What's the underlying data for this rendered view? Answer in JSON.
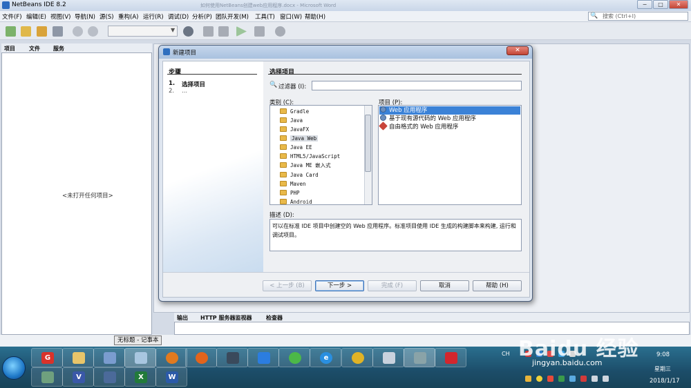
{
  "app": {
    "title": "NetBeans IDE 8.2",
    "background_doc_title": "如何使用NetBeans创建web应用程序.docx - Microsoft Word"
  },
  "menubar": {
    "items": [
      "文件(F)",
      "编辑(E)",
      "视图(V)",
      "导航(N)",
      "源(S)",
      "重构(A)",
      "运行(R)",
      "调试(D)",
      "分析(P)",
      "团队开发(M)",
      "工具(T)",
      "窗口(W)",
      "帮助(H)"
    ],
    "search_placeholder": "搜索 (Ctrl+I)"
  },
  "project_panel": {
    "tabs": [
      "项目",
      "文件",
      "服务"
    ],
    "empty_text": "<未打开任何项目>"
  },
  "output_panel": {
    "tabs": [
      "输出",
      "HTTP 服务器监视器",
      "检查器"
    ]
  },
  "tooltip": "无标题 - 记事本",
  "dialog": {
    "title": "新建项目",
    "steps_heading": "步骤",
    "steps": [
      {
        "num": "1.",
        "label": "选择项目"
      },
      {
        "num": "2.",
        "label": "..."
      }
    ],
    "section_heading": "选择项目",
    "filter_label": "过滤器 (I):",
    "filter_value": "",
    "categories_label": "类别 (C):",
    "categories": [
      "Gradle",
      "Java",
      "JavaFX",
      "Java Web",
      "Java EE",
      "HTML5/JavaScript",
      "Java ME 嵌入式",
      "Java Card",
      "Maven",
      "PHP",
      "Android"
    ],
    "selected_category": "Java Web",
    "projects_label": "项目 (P):",
    "projects": [
      "Web 应用程序",
      "基于现有源代码的 Web 应用程序",
      "自由格式的 Web 应用程序"
    ],
    "selected_project": "Web 应用程序",
    "description_label": "描述 (D):",
    "description": "可以在标准 IDE 项目中创建空的 Web 应用程序。标准项目使用 IDE 生成的构建脚本来构建, 运行和调试项目。",
    "buttons": {
      "back": "< 上一步 (B)",
      "next": "下一步 >",
      "finish": "完成 (F)",
      "cancel": "取消",
      "help": "帮助 (H)"
    }
  },
  "taskbar": {
    "input_indicator": "CH",
    "time": "9:08",
    "weekday": "星期三",
    "date": "2018/1/17",
    "watermark": "Baidu 经验",
    "watermark_url": "jingyan.baidu.com"
  },
  "colors": {
    "selection": "#3b82d7",
    "taskbar": "#1c4d69",
    "dialog_close": "#c24535"
  }
}
